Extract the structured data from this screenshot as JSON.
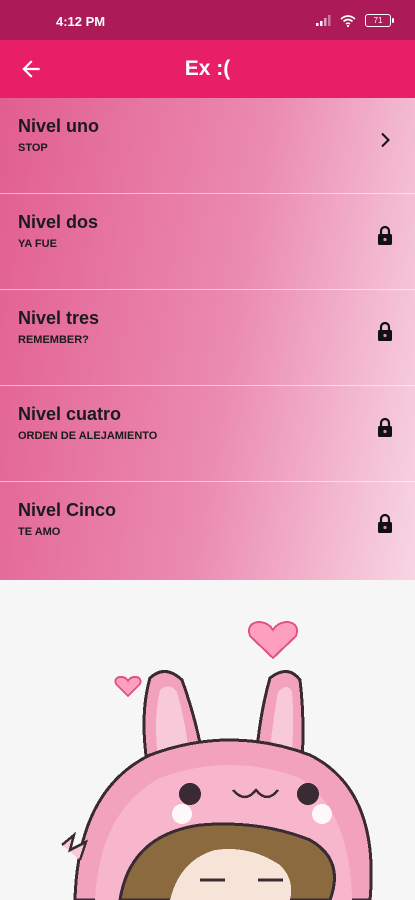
{
  "status_bar": {
    "time": "4:12 PM",
    "battery": "71",
    "icons": [
      "signal-icon",
      "wifi-icon",
      "battery-icon"
    ]
  },
  "app_bar": {
    "title": "Ex :(",
    "back_icon": "arrow-back-icon"
  },
  "levels": [
    {
      "title": "Nivel uno",
      "subtitle": "STOP",
      "icon": "chevron-right-icon"
    },
    {
      "title": "Nivel dos",
      "subtitle": "YA FUE",
      "icon": "lock-icon"
    },
    {
      "title": "Nivel tres",
      "subtitle": "REMEMBER?",
      "icon": "lock-icon"
    },
    {
      "title": "Nivel cuatro",
      "subtitle": "ORDEN DE ALEJAMIENTO",
      "icon": "lock-icon"
    },
    {
      "title": "Nivel Cinco",
      "subtitle": "TE AMO",
      "icon": "lock-icon"
    }
  ],
  "colors": {
    "status_bar": "#ac1a58",
    "app_bar": "#e81f67",
    "list_gradient_start": "#e15e90",
    "list_gradient_end": "#f8d6e4"
  }
}
